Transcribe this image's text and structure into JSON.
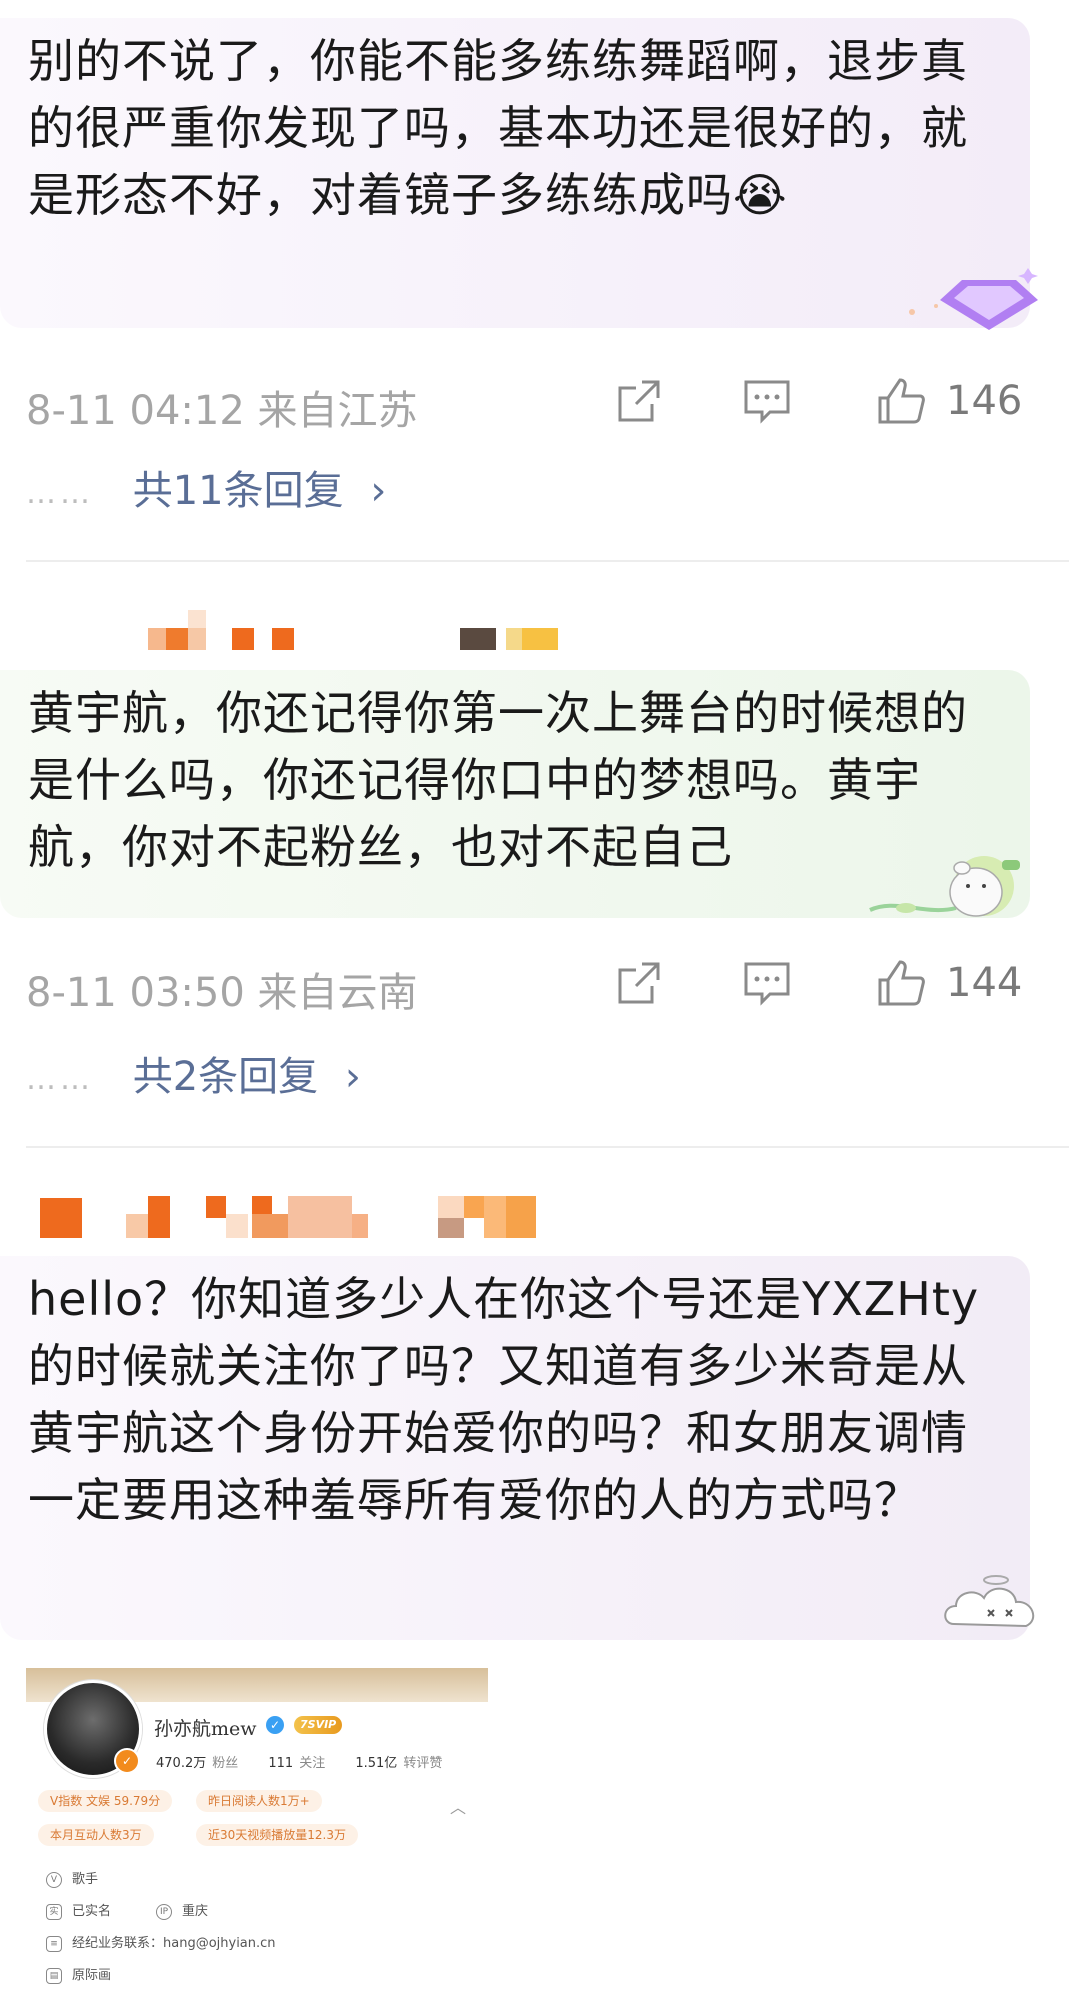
{
  "comments": [
    {
      "text": "别的不说了，你能不能多练练舞蹈啊，退步真的很严重你发现了吗，基本功还是很好的，就是形态不好，对着镜子多练练成吗😭",
      "time_location": "8-11 04:12 来自江苏",
      "likes": "146",
      "replies": "共11条回复"
    },
    {
      "text": "黄宇航，你还记得你第一次上舞台的时候想的是什么吗，你还记得你口中的梦想吗。黄宇航，你对不起粉丝，也对不起自己",
      "time_location": "8-11 03:50 来自云南",
      "likes": "144",
      "replies": "共2条回复"
    },
    {
      "text": "hello？你知道多少人在你这个号还是YXZHty的时候就关注你了吗？又知道有多少米奇是从黄宇航这个身份开始爱你的吗？和女朋友调情一定要用这种羞辱所有爱你的人的方式吗？"
    }
  ],
  "reply_dots": "……",
  "reply_arrow": "›",
  "icons": [
    "share-icon",
    "comment-icon",
    "like-icon"
  ],
  "accent": {
    "reply_link": "#5a6e96",
    "meta_gray": "#a5a5a5",
    "orange": "#f28b1d"
  },
  "profile": {
    "name": "孙亦航mew",
    "vip_badge": "7SVIP",
    "followers_num": "470.2万",
    "followers_label": "粉丝",
    "following_num": "111",
    "following_label": "关注",
    "likes_num": "1.51亿",
    "likes_label": "转评赞",
    "tags": [
      "V指数 文娱 59.79分",
      "昨日阅读人数1万+",
      "本月互动人数3万",
      "近30天视频播放量12.3万"
    ],
    "info": [
      {
        "icon": "V",
        "text": "歌手"
      },
      {
        "icon": "实",
        "text": "已实名"
      },
      {
        "icon": "IP",
        "text": "重庆"
      },
      {
        "icon": "≡",
        "text": "经纪业务联系：hang@ojhyian.cn"
      },
      {
        "icon": "▤",
        "text": "原际画"
      }
    ]
  }
}
